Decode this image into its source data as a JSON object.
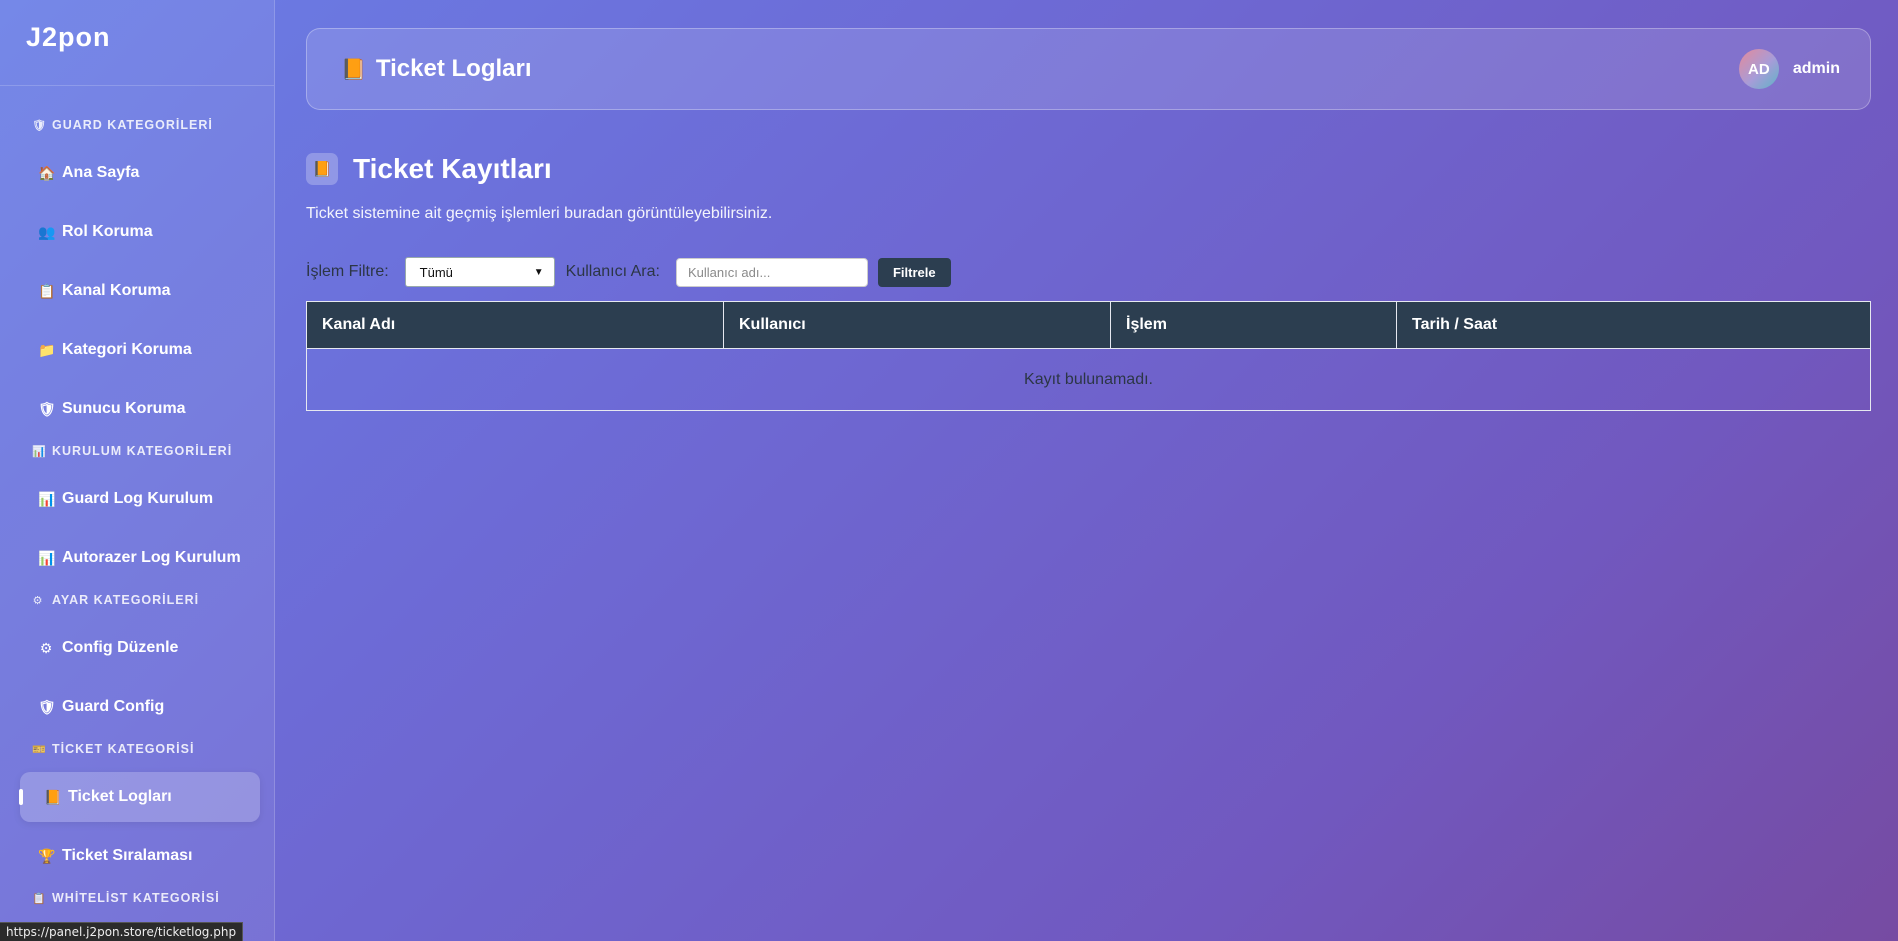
{
  "brand": "J2pon",
  "sidebar": {
    "sections": [
      {
        "icon": "🛡",
        "icon_name": "shield-icon",
        "label": "GUARD KATEGORİLERİ"
      },
      {
        "icon": "📊",
        "icon_name": "chart-icon",
        "label": "KURULUM KATEGORİLERİ"
      },
      {
        "icon": "⚙",
        "icon_name": "gear-icon",
        "label": "AYAR KATEGORİLERİ"
      },
      {
        "icon": "🎫",
        "icon_name": "ticket-icon",
        "label": "TİCKET KATEGORİSİ"
      },
      {
        "icon": "📋",
        "icon_name": "clipboard-icon",
        "label": "WHİTELİST KATEGORİSİ"
      }
    ],
    "items": [
      {
        "icon": "🏠",
        "icon_name": "home-icon",
        "label": "Ana Sayfa"
      },
      {
        "icon": "👥",
        "icon_name": "users-icon",
        "label": "Rol Koruma"
      },
      {
        "icon": "📋",
        "icon_name": "clipboard-icon",
        "label": "Kanal Koruma"
      },
      {
        "icon": "📁",
        "icon_name": "folder-icon",
        "label": "Kategori Koruma"
      },
      {
        "icon": "🛡",
        "icon_name": "shield-icon",
        "label": "Sunucu Koruma"
      },
      {
        "icon": "📊",
        "icon_name": "chart-icon",
        "label": "Guard Log Kurulum"
      },
      {
        "icon": "📊",
        "icon_name": "chart-icon",
        "label": "Autorazer Log Kurulum"
      },
      {
        "icon": "⚙",
        "icon_name": "gear-icon",
        "label": "Config Düzenle"
      },
      {
        "icon": "🛡",
        "icon_name": "shield-icon",
        "label": "Guard Config"
      },
      {
        "icon": "📙",
        "icon_name": "ledger-icon",
        "label": "Ticket Logları"
      },
      {
        "icon": "🏆",
        "icon_name": "trophy-icon",
        "label": "Ticket Sıralaması"
      }
    ],
    "active_item": "Ticket Logları"
  },
  "header": {
    "icon": "📙",
    "icon_name": "ledger-icon",
    "title": "Ticket Logları",
    "user_initials": "AD",
    "username": "admin"
  },
  "main": {
    "icon": "📙",
    "title": "Ticket Kayıtları",
    "subtitle": "Ticket sistemine ait geçmiş işlemleri buradan görüntüleyebilirsiniz.",
    "filter": {
      "action_label": "İşlem Filtre:",
      "action_value": "Tümü",
      "user_label": "Kullanıcı Ara:",
      "user_placeholder": "Kullanıcı adı...",
      "button": "Filtrele"
    },
    "table": {
      "columns": [
        "Kanal Adı",
        "Kullanıcı",
        "İşlem",
        "Tarih / Saat"
      ],
      "empty_text": "Kayıt bulunamadı."
    }
  },
  "statusbar": "https://panel.j2pon.store/ticketlog.php",
  "colors": {
    "table_header": "#2c3e50",
    "button": "#2c3e50",
    "gradient_start": "#6a7ee6",
    "gradient_end": "#764ba2"
  }
}
